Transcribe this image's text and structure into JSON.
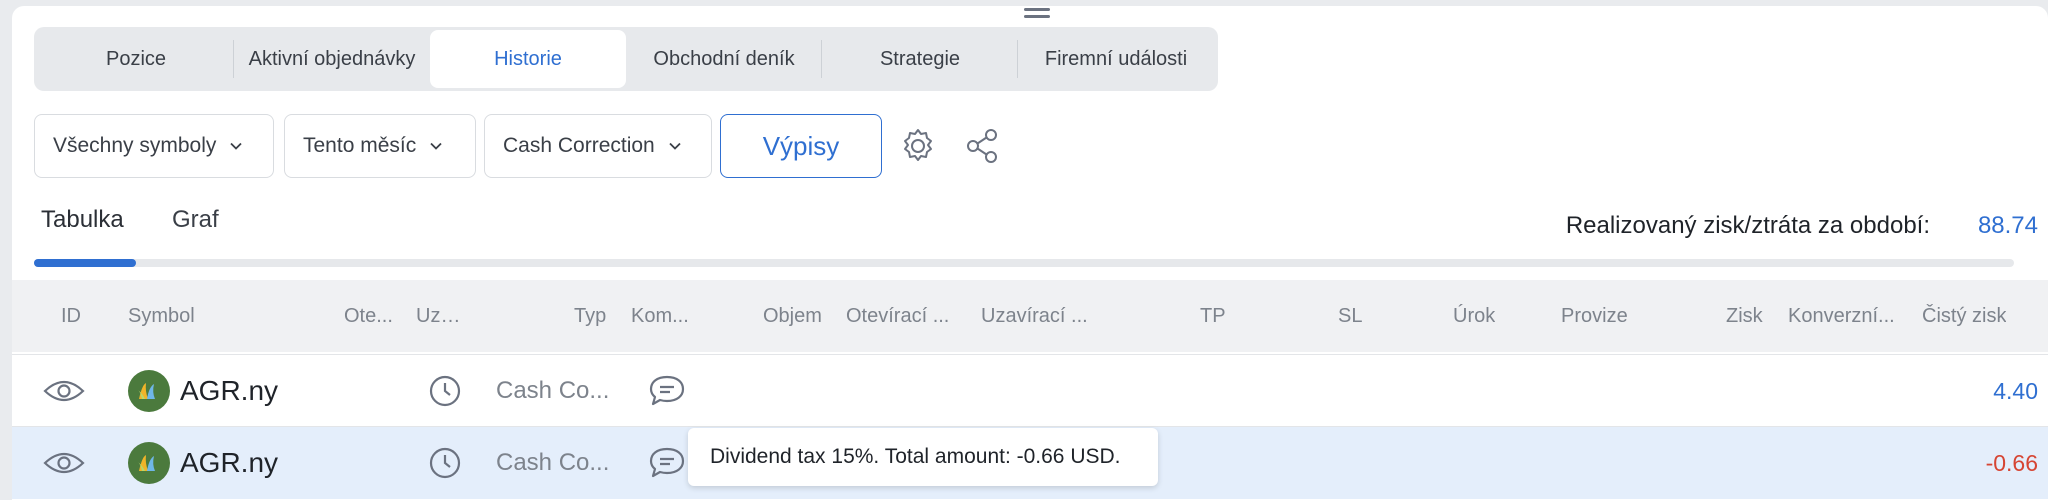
{
  "tabs": [
    {
      "label": "Pozice"
    },
    {
      "label": "Aktivní objednávky"
    },
    {
      "label": "Historie",
      "active": true
    },
    {
      "label": "Obchodní deník"
    },
    {
      "label": "Strategie"
    },
    {
      "label": "Firemní události"
    }
  ],
  "filters": {
    "symbols": "Všechny symboly",
    "period": "Tento měsíc",
    "type": "Cash Correction",
    "statements_button": "Výpisy"
  },
  "subtabs": {
    "table": "Tabulka",
    "chart": "Graf"
  },
  "summary": {
    "label": "Realizovaný zisk/ztráta za období:",
    "value": "88.74"
  },
  "columns": {
    "id": "ID",
    "symbol": "Symbol",
    "open_time": "Ote...",
    "close_time": "Uza...",
    "type": "Typ",
    "comment": "Kom...",
    "volume": "Objem",
    "open_price": "Otevírací ...",
    "close_price": "Uzavírací ...",
    "tp": "TP",
    "sl": "SL",
    "interest": "Úrok",
    "commission": "Provize",
    "profit": "Zisk",
    "conversion": "Konverzní...",
    "net_profit": "Čistý zisk"
  },
  "rows": [
    {
      "symbol": "AGR.ny",
      "type": "Cash Co...",
      "net_profit": "4.40",
      "net_color": "#2f6fd1"
    },
    {
      "symbol": "AGR.ny",
      "type": "Cash Co...",
      "net_profit": "-0.66",
      "net_color": "#d64533"
    }
  ],
  "tooltip": {
    "text": "Dividend tax 15%. Total amount: -0.66 USD."
  },
  "colors": {
    "accent": "#2f6fd1",
    "negative": "#d64533",
    "selected_row": "#e4eefb"
  }
}
